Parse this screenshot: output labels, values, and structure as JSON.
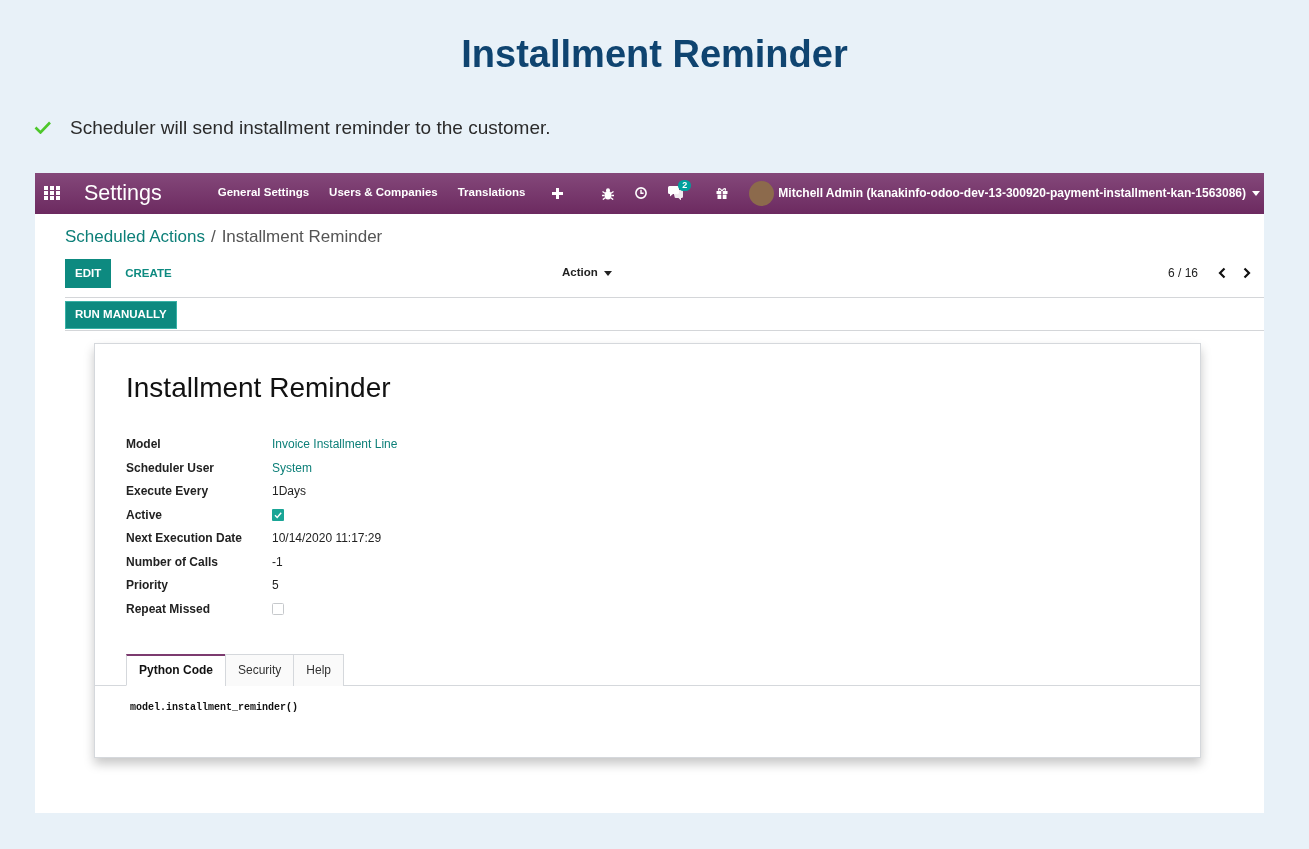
{
  "page": {
    "title": "Installment Reminder",
    "points": [
      {
        "text": "Scheduler will send installment reminder to the customer."
      }
    ]
  },
  "navbar": {
    "app_name": "Settings",
    "menu": [
      {
        "label": "General Settings"
      },
      {
        "label": "Users & Companies"
      },
      {
        "label": "Translations"
      }
    ],
    "messages_badge": "2",
    "user": "Mitchell Admin (kanakinfo-odoo-dev-13-300920-payment-installment-kan-1563086)"
  },
  "breadcrumb": {
    "items": [
      {
        "label": "Scheduled Actions",
        "kind": "link"
      },
      {
        "label": "Installment Reminder",
        "kind": "current"
      }
    ],
    "separator": "/"
  },
  "toolbar": {
    "buttons": [
      {
        "label": "EDIT",
        "kind": "primary"
      },
      {
        "label": "CREATE",
        "kind": "link"
      }
    ],
    "action_menu": "Action",
    "pager": "6 / 16"
  },
  "header_buttons": [
    {
      "label": "RUN MANUALLY"
    }
  ],
  "form": {
    "title": "Installment Reminder",
    "fields": [
      {
        "label": "Model",
        "kind": "link",
        "value": "Invoice Installment Line"
      },
      {
        "label": "Scheduler User",
        "kind": "link",
        "value": "System"
      },
      {
        "label": "Execute Every",
        "kind": "text",
        "value": "1Days"
      },
      {
        "label": "Active",
        "kind": "checkbox",
        "checked": true
      },
      {
        "label": "Next Execution Date",
        "kind": "text",
        "value": "10/14/2020 11:17:29"
      },
      {
        "label": "Number of Calls",
        "kind": "text",
        "value": "-1"
      },
      {
        "label": "Priority",
        "kind": "text",
        "value": "5"
      },
      {
        "label": "Repeat Missed",
        "kind": "checkbox",
        "checked": false
      }
    ],
    "tabs": [
      {
        "label": "Python Code",
        "selected": true
      },
      {
        "label": "Security",
        "selected": false
      },
      {
        "label": "Help",
        "selected": false
      }
    ],
    "code": "model.installment_reminder()"
  }
}
